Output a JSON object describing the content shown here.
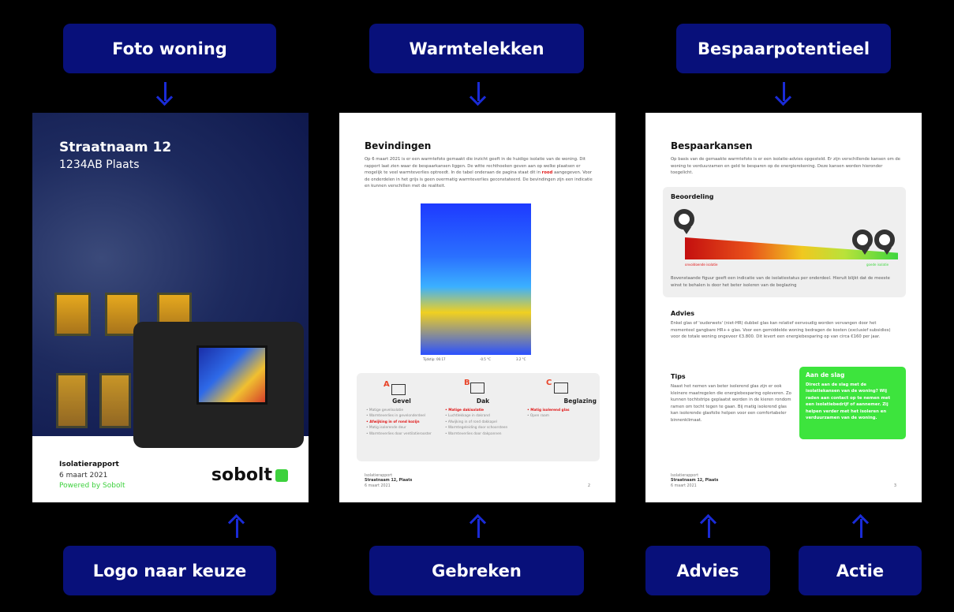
{
  "labels": {
    "photo": "Foto woning",
    "leaks": "Warmtelekken",
    "savings": "Bespaarpotentieel",
    "logo": "Logo naar keuze",
    "defects": "Gebreken",
    "advice": "Advies",
    "action": "Actie"
  },
  "cover": {
    "street": "Straatnaam 12",
    "city": "1234AB Plaats",
    "report": "Isolatierapport",
    "date": "6 maart 2021",
    "powered": "Powered by Sobolt",
    "brand": "sobolt"
  },
  "page2": {
    "title": "Bevindingen",
    "intro_a": "Op 6 maart 2021 is er een warmtefoto gemaakt die inzicht geeft in de huidige isolatie van de woning. Dit rapport laat zien waar de bespaarkansen liggen. De witte rechthoeken geven aan op welke plaatsen er mogelijk te veel warmteverlies optreedt. In de tabel onderaan de pagina staat dit in",
    "intro_red": "rood",
    "intro_b": "aangegeven. Voor de onderdelen in het grijs is geen overmatig warmteverlies geconstateerd. De bevindingen zijn een indicatie en kunnen verschillen met de realiteit.",
    "thermal_time": "Tijdstip: 06:17",
    "thermal_min": "-0.5 °C",
    "thermal_max": "3.2 °C",
    "columns": [
      {
        "letter": "A",
        "title": "Gevel",
        "items": [
          "Matige gevelisolatie",
          "Warmteverlies in gevelonderdeel",
          "Afwijking in of rond kozijn",
          "Matig isolerende deur",
          "Warmteverlies door ventilatierooster"
        ],
        "red": [
          2
        ]
      },
      {
        "letter": "B",
        "title": "Dak",
        "items": [
          "Matige dakisolatie",
          "Luchtlekkage in dakrand",
          "Afwijking in of rond dakkapel",
          "Warmtegeleiding door schoorsteen",
          "Warmteverlies door dakpannen"
        ],
        "red": [
          0
        ]
      },
      {
        "letter": "C",
        "title": "Beglazing",
        "items": [
          "Matig isolerend glas",
          "Open raam"
        ],
        "red": [
          0
        ]
      }
    ],
    "footer_report": "Isolatierapport",
    "footer_addr": "Straatnaam 12, Plaats",
    "footer_date": "6 maart 2021",
    "page_num": "2"
  },
  "page3": {
    "title": "Bespaarkansen",
    "intro": "Op basis van de gemaakte warmtefoto is er een isolatie-advies opgesteld. Er zijn verschillende kansen om de woning te verduurzamen en geld te besparen op de energierekening. Deze kansen worden hieronder toegelicht.",
    "rating_title": "Beoordeling",
    "bar_left": "onvoldoende isolatie",
    "bar_right": "goede isolatie",
    "rating_text": "Bovenstaande figuur geeft een indicatie van de isolatiestatus per onderdeel. Hieruit blijkt dat de meeste winst te behalen is door het beter isoleren van de beglazing",
    "advice_title": "Advies",
    "advice_text": "Enkel glas of 'ouderwets' (niet-HR) dubbel glas kan relatief eenvoudig worden vervangen door het momenteel gangbare HR++ glas. Voor een gemiddelde woning bedragen de kosten (exclusief subsidies) voor de totale woning ongeveer €3.800. Dit levert een energiebesparing op van circa €160 per jaar.",
    "tips_title": "Tips",
    "tips_text": "Naast het nemen van beter isolerend glas zijn er ook kleinere maatregelen die energiebesparing opleveren. Zo kunnen tochtstrips geplaatst worden in de kieren rondom ramen om tocht tegen te gaan. Bij matig isolerend glas kan isolerende glasfolie helpen voor een comfortabeler binnenklimaat.",
    "action_title": "Aan de slag",
    "action_text": "Direct aan de slag met de isolatiekansen van de woning? Wij raden aan contact op te nemen met een isolatiebedrijf of aannemer. Zij helpen verder met het isoleren en verduurzamen van de woning.",
    "footer_report": "Isolatierapport",
    "footer_addr": "Straatnaam 12, Plaats",
    "footer_date": "6 maart 2021",
    "page_num": "3"
  }
}
